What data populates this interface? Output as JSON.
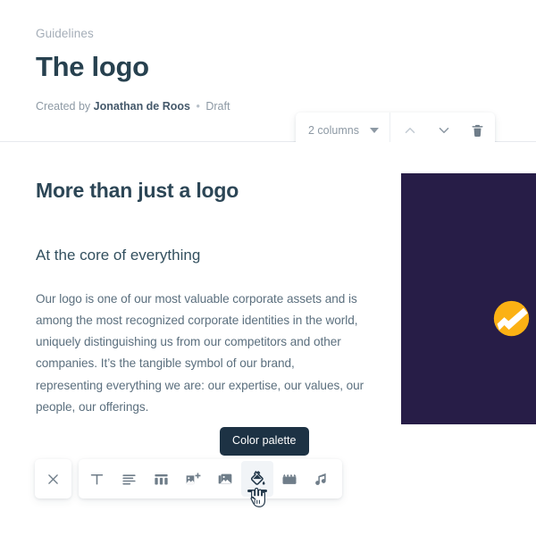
{
  "header": {
    "breadcrumb": "Guidelines",
    "title": "The logo",
    "meta": {
      "created_prefix": "Created by",
      "author": "Jonathan de Roos",
      "separator": "•",
      "status": "Draft"
    }
  },
  "block_toolbar": {
    "columns_value": "2 columns",
    "caret_icon": "chevron-down-icon",
    "move_up_label": "Move up",
    "move_up_icon": "chevron-up-icon",
    "move_down_label": "Move down",
    "move_down_icon": "chevron-down-icon",
    "delete_label": "Delete block",
    "delete_icon": "trash-icon"
  },
  "content": {
    "heading": "More than just a logo",
    "subheading": "At the core of everything",
    "paragraph": "Our logo is one of our most valuable corporate assets and is among the most recognized corporate identities in the world, uniquely distinguishing us from our competitors and other companies. It’s the tangible symbol of our brand, representing everything we are: our expertise, our values, our people, our offerings."
  },
  "logo_panel": {
    "name": "brand-logo-panel",
    "background_color": "#271d47",
    "mark_color": "#fbb114",
    "mark_icon": "chart-circle-logo-mark"
  },
  "tooltip": {
    "text": "Color palette"
  },
  "insert_toolbar": {
    "close_label": "Close",
    "close_icon": "close-icon",
    "tools": [
      {
        "name": "text",
        "label": "Text",
        "icon": "text-t-icon",
        "active": false
      },
      {
        "name": "paragraph",
        "label": "Paragraph",
        "icon": "align-left-icon",
        "active": false
      },
      {
        "name": "columns",
        "label": "Columns",
        "icon": "columns-icon",
        "active": false
      },
      {
        "name": "add-image",
        "label": "Add image",
        "icon": "image-plus-icon",
        "active": false
      },
      {
        "name": "gallery",
        "label": "Gallery",
        "icon": "image-stack-icon",
        "active": false
      },
      {
        "name": "color-palette",
        "label": "Color palette",
        "icon": "paint-bucket-icon",
        "active": true
      },
      {
        "name": "video",
        "label": "Video",
        "icon": "clapperboard-icon",
        "active": false
      },
      {
        "name": "audio",
        "label": "Audio",
        "icon": "music-note-icon",
        "active": false
      }
    ]
  },
  "colors": {
    "title_text": "#27414f",
    "body_text": "#5b6f7e",
    "muted_text": "#8d99a4",
    "panel_dark": "#271d47",
    "brand_amber": "#fbb114",
    "tooltip_bg": "#1d3244",
    "divider": "#e7eaee"
  }
}
